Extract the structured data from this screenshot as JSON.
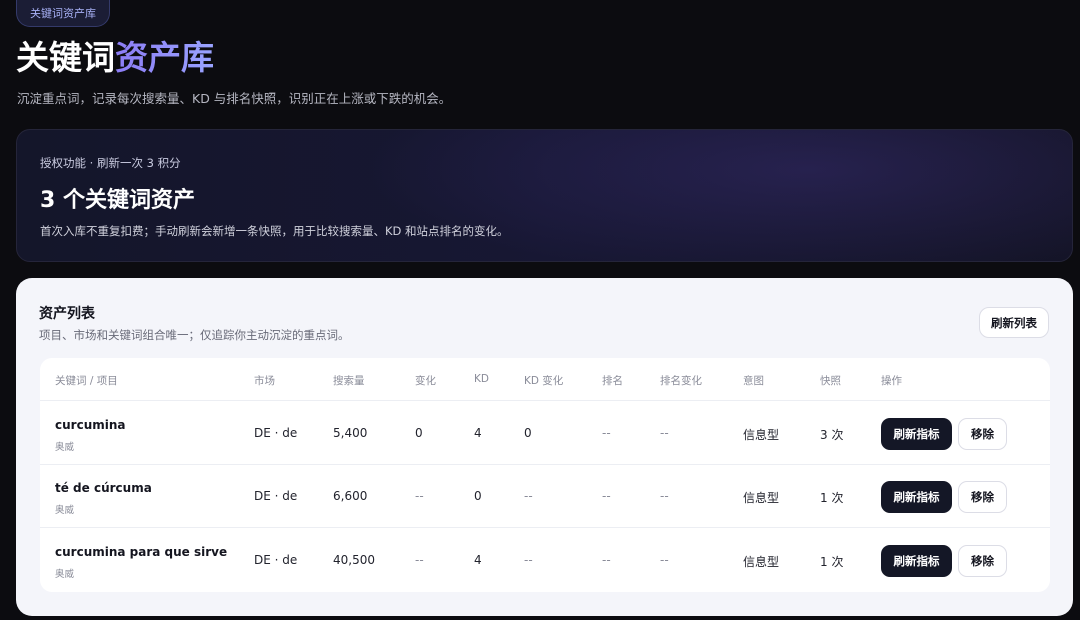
{
  "header": {
    "badge": "关键词资产库",
    "title_main": "关键词",
    "title_accent": "资产库",
    "subtitle": "沉淀重点词，记录每次搜索量、KD 与排名快照，识别正在上涨或下跌的机会。"
  },
  "hero": {
    "kicker": "授权功能 · 刷新一次 3 积分",
    "count": "3 个关键词资产",
    "desc": "首次入库不重复扣费；手动刷新会新增一条快照，用于比较搜索量、KD 和站点排名的变化。"
  },
  "list": {
    "title": "资产列表",
    "subtitle": "项目、市场和关键词组合唯一；仅追踪你主动沉淀的重点词。",
    "refresh_list_label": "刷新列表",
    "columns": [
      "关键词 / 项目",
      "市场",
      "搜索量",
      "变化",
      "KD",
      "KD 变化",
      "排名",
      "排名变化",
      "意图",
      "快照",
      "操作"
    ],
    "rows": [
      {
        "keyword": "curcumina",
        "project": "奥威",
        "market": "DE · de",
        "volume": "5,400",
        "change": "0",
        "kd": "4",
        "kd_change": "0",
        "rank": "--",
        "rank_change": "--",
        "intent": "信息型",
        "snapshots": "3 次"
      },
      {
        "keyword": "té de cúrcuma",
        "project": "奥威",
        "market": "DE · de",
        "volume": "6,600",
        "change": "--",
        "kd": "0",
        "kd_change": "--",
        "rank": "--",
        "rank_change": "--",
        "intent": "信息型",
        "snapshots": "1 次"
      },
      {
        "keyword": "curcumina para que sirve",
        "project": "奥威",
        "market": "DE · de",
        "volume": "40,500",
        "change": "--",
        "kd": "4",
        "kd_change": "--",
        "rank": "--",
        "rank_change": "--",
        "intent": "信息型",
        "snapshots": "1 次"
      }
    ],
    "refresh_row_label": "刷新指标",
    "remove_row_label": "移除"
  }
}
